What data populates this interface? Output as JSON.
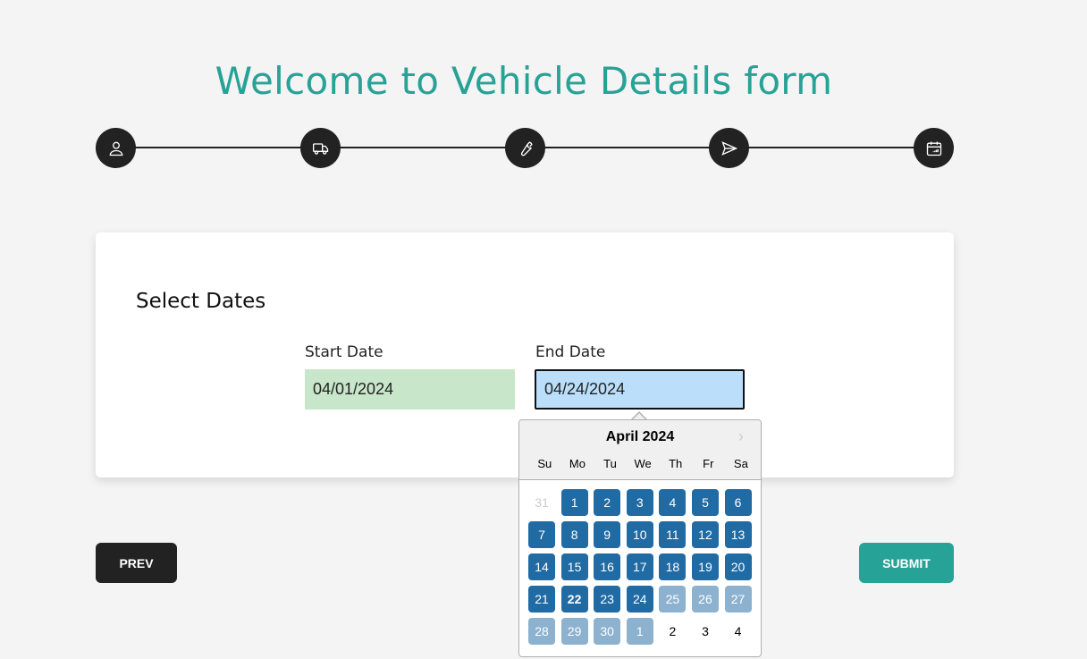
{
  "page": {
    "title": "Welcome to Vehicle Details form"
  },
  "stepper": {
    "steps": [
      {
        "icon": "user-icon"
      },
      {
        "icon": "truck-icon"
      },
      {
        "icon": "wrench-icon"
      },
      {
        "icon": "send-icon"
      },
      {
        "icon": "calendar-icon"
      }
    ]
  },
  "card": {
    "title": "Select Dates",
    "start_label": "Start Date",
    "start_value": "04/01/2024",
    "end_label": "End Date",
    "end_value": "04/24/2024"
  },
  "buttons": {
    "prev": "PREV",
    "submit": "SUBMIT"
  },
  "datepicker": {
    "month": "April 2024",
    "next_icon": "chevron-right-icon",
    "weekdays": [
      "Su",
      "Mo",
      "Tu",
      "We",
      "Th",
      "Fr",
      "Sa"
    ],
    "weeks": [
      [
        {
          "d": "31",
          "s": "outside"
        },
        {
          "d": "1",
          "s": "sel"
        },
        {
          "d": "2",
          "s": "sel"
        },
        {
          "d": "3",
          "s": "sel"
        },
        {
          "d": "4",
          "s": "sel"
        },
        {
          "d": "5",
          "s": "sel"
        },
        {
          "d": "6",
          "s": "sel"
        }
      ],
      [
        {
          "d": "7",
          "s": "sel"
        },
        {
          "d": "8",
          "s": "sel"
        },
        {
          "d": "9",
          "s": "sel"
        },
        {
          "d": "10",
          "s": "sel"
        },
        {
          "d": "11",
          "s": "sel"
        },
        {
          "d": "12",
          "s": "sel"
        },
        {
          "d": "13",
          "s": "sel"
        }
      ],
      [
        {
          "d": "14",
          "s": "sel"
        },
        {
          "d": "15",
          "s": "sel"
        },
        {
          "d": "16",
          "s": "sel"
        },
        {
          "d": "17",
          "s": "sel"
        },
        {
          "d": "18",
          "s": "sel"
        },
        {
          "d": "19",
          "s": "sel"
        },
        {
          "d": "20",
          "s": "sel"
        }
      ],
      [
        {
          "d": "21",
          "s": "sel"
        },
        {
          "d": "22",
          "s": "sel today"
        },
        {
          "d": "23",
          "s": "sel"
        },
        {
          "d": "24",
          "s": "sel"
        },
        {
          "d": "25",
          "s": "range"
        },
        {
          "d": "26",
          "s": "range"
        },
        {
          "d": "27",
          "s": "range"
        }
      ],
      [
        {
          "d": "28",
          "s": "range"
        },
        {
          "d": "29",
          "s": "range"
        },
        {
          "d": "30",
          "s": "range"
        },
        {
          "d": "1",
          "s": "range"
        },
        {
          "d": "2",
          "s": ""
        },
        {
          "d": "3",
          "s": ""
        },
        {
          "d": "4",
          "s": ""
        }
      ]
    ]
  },
  "colors": {
    "accent": "#27a296",
    "selected": "#216ba5",
    "range": "#8db2cf",
    "start_bg": "#c8e6c9",
    "end_bg": "#bbdefb"
  }
}
